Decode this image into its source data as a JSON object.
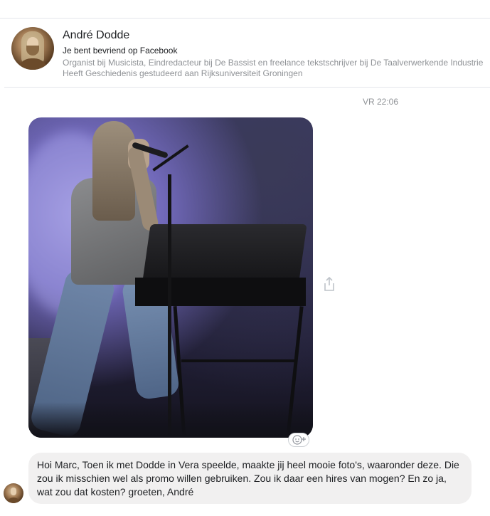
{
  "contact": {
    "name": "André Dodde",
    "friend_status": "Je bent bevriend op Facebook",
    "work": "Organist bij Musicista, Eindredacteur bij De Bassist en freelance tekstschrijver bij De Taalverwerkende Industrie",
    "education": "Heeft Geschiedenis gestudeerd aan Rijksuniversiteit Groningen"
  },
  "conversation": {
    "timestamp": "VR 22:06",
    "messages": [
      {
        "type": "photo",
        "icons": [
          "share-icon",
          "add-reaction-icon"
        ]
      },
      {
        "type": "text",
        "text": "Hoi Marc, Toen ik met Dodde in Vera speelde, maakte jij heel mooie foto's, waaronder deze. Die zou ik misschien wel als promo willen gebruiken. Zou ik daar een hires van mogen? En zo ja, wat zou dat kosten? groeten, André"
      }
    ]
  },
  "colors": {
    "bubble": "#f1f0f0",
    "meta_text": "#8f9296",
    "divider": "#e4e6eb"
  }
}
